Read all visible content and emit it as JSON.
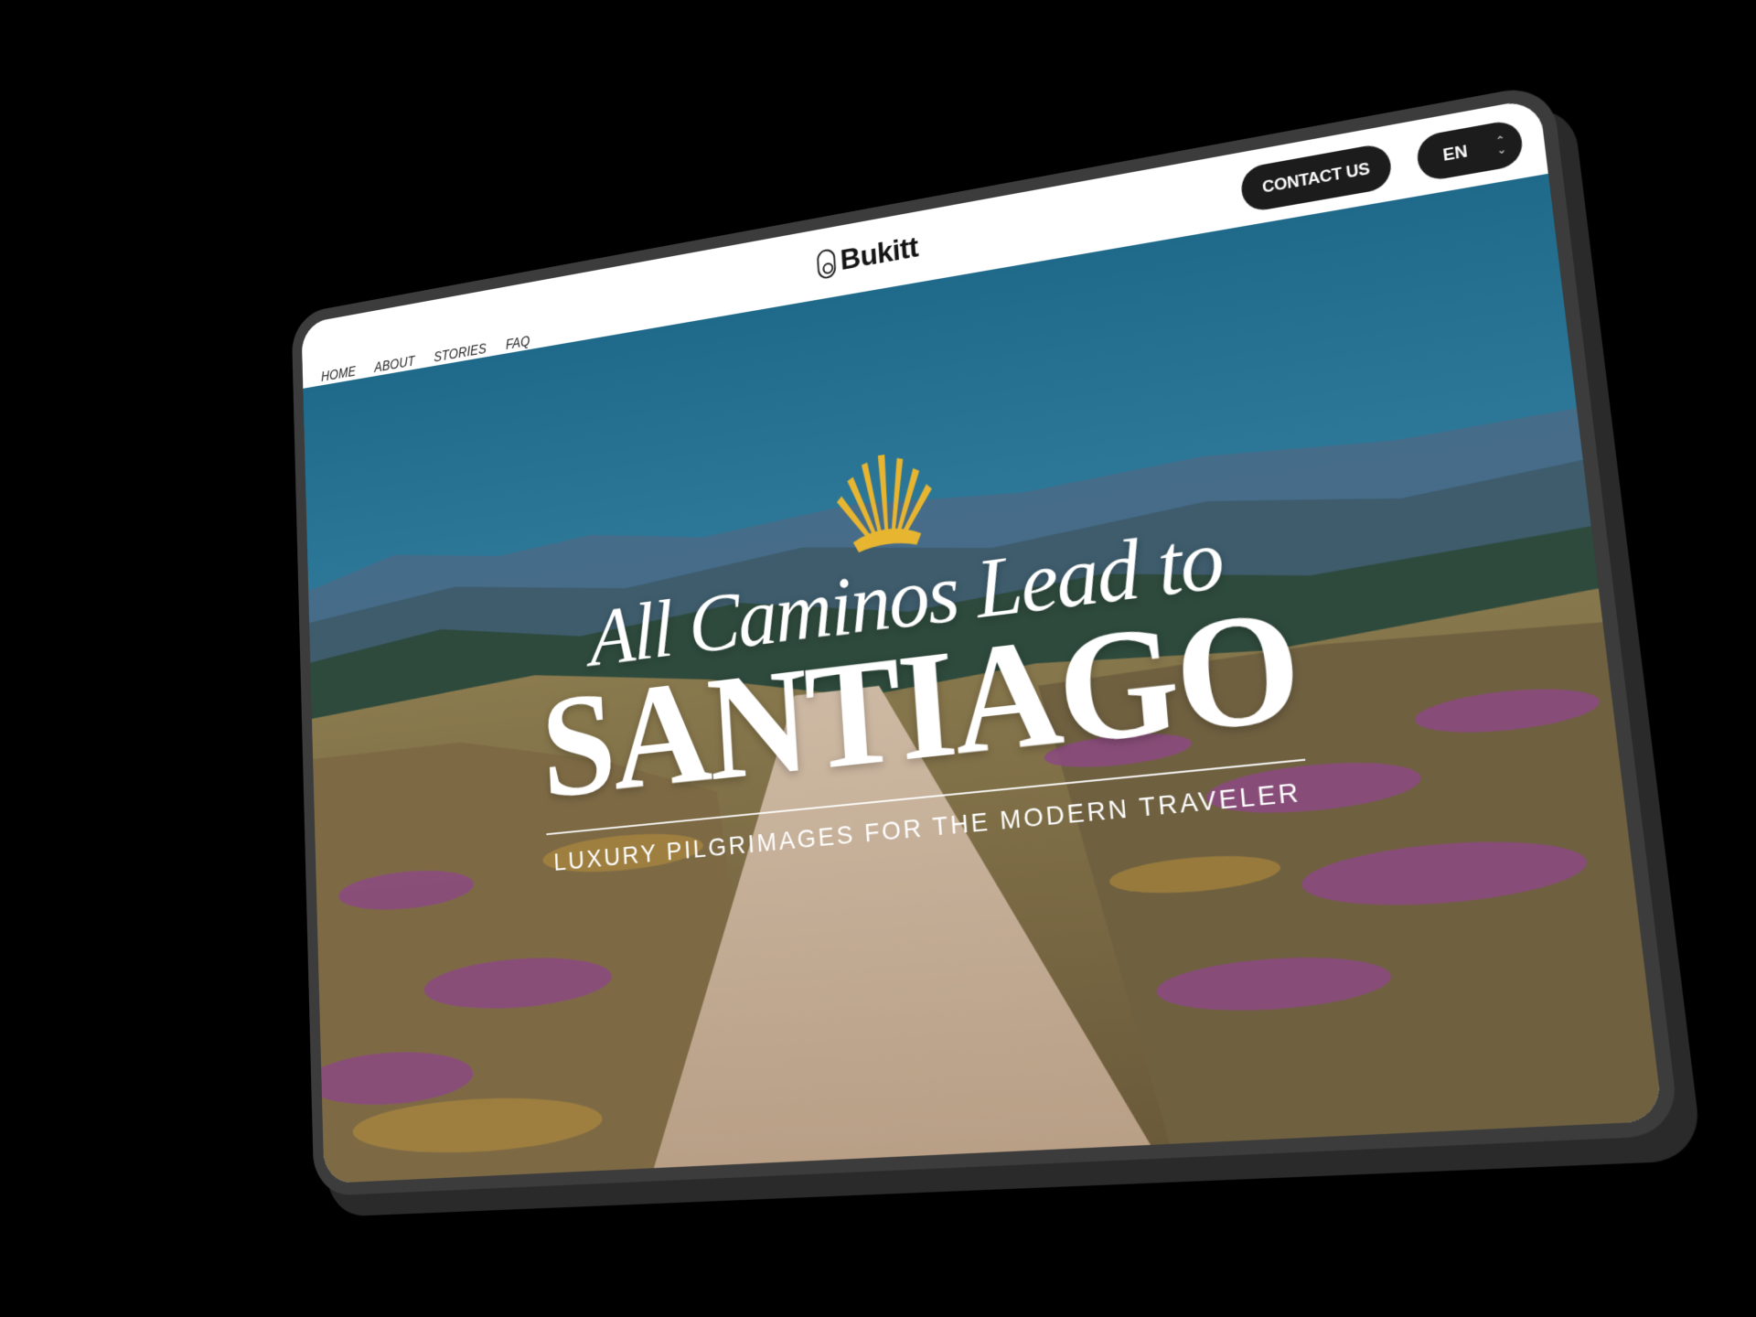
{
  "nav": {
    "items": [
      {
        "label": "HOME"
      },
      {
        "label": "ABOUT"
      },
      {
        "label": "STORIES"
      },
      {
        "label": "FAQ"
      }
    ]
  },
  "brand": {
    "name": "Bukitt"
  },
  "header": {
    "contact_label": "CONTACT US",
    "language": "EN"
  },
  "hero": {
    "title_line1": "All Caminos Lead to",
    "title_line2": "SANTIAGO",
    "tagline": "LUXURY PILGRIMAGES FOR THE MODERN TRAVELER",
    "shell_icon": "scallop-shell-icon"
  },
  "colors": {
    "accent_gold": "#e8b531",
    "dark_button": "#1c1c1c",
    "sky": "#2c6f8c",
    "heather": "#8c4a82"
  }
}
